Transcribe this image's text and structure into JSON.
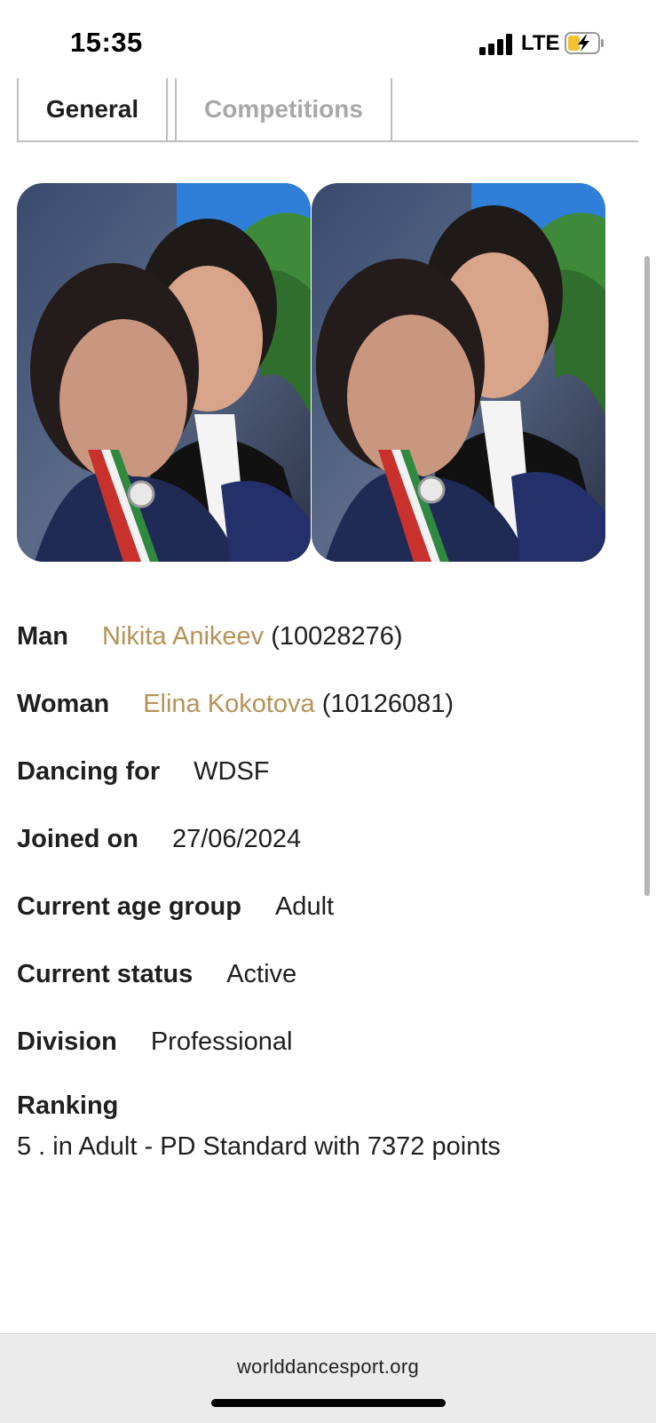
{
  "status_bar": {
    "time": "15:35",
    "network": "LTE",
    "battery_icon": "battery-charging-icon",
    "signal_icon": "signal-bars-icon",
    "battery_color": "#f2c230"
  },
  "tabs": [
    {
      "label": "General",
      "active": true
    },
    {
      "label": "Competitions",
      "active": false
    }
  ],
  "photos": [
    {
      "name": "couple-photo-man"
    },
    {
      "name": "couple-photo-woman"
    }
  ],
  "details": {
    "man": {
      "label": "Man",
      "name": "Nikita Anikeev",
      "id": "(10028276)"
    },
    "woman": {
      "label": "Woman",
      "name": "Elina Kokotova",
      "id": "(10126081)"
    },
    "dancing_for": {
      "label": "Dancing for",
      "value": "WDSF"
    },
    "joined_on": {
      "label": "Joined on",
      "value": "27/06/2024"
    },
    "age_group": {
      "label": "Current age group",
      "value": "Adult"
    },
    "status": {
      "label": "Current status",
      "value": "Active"
    },
    "division": {
      "label": "Division",
      "value": "Professional"
    },
    "ranking": {
      "label": "Ranking",
      "value": "5 . in Adult - PD Standard with 7372 points"
    }
  },
  "browser": {
    "url": "worlddancesport.org"
  },
  "colors": {
    "link": "#b59357",
    "tab_inactive": "#a8a8a8",
    "text": "#1f1f1f"
  }
}
